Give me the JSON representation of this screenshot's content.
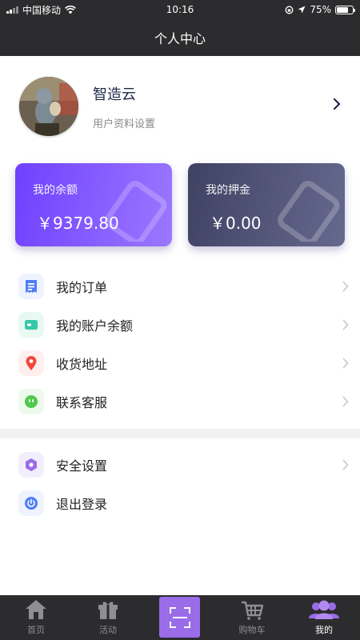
{
  "status_bar": {
    "carrier": "中国移动",
    "time": "10:16",
    "battery": "75%"
  },
  "header": {
    "title": "个人中心"
  },
  "profile": {
    "name": "智造云",
    "subtitle": "用户资料设置"
  },
  "cards": [
    {
      "title": "我的余额",
      "amount": "￥9379.80"
    },
    {
      "title": "我的押金",
      "amount": "￥0.00"
    }
  ],
  "menu_group_1": [
    {
      "label": "我的订单",
      "icon": "order-icon",
      "icon_color": "#4e7ef7",
      "bg": "#eef3ff"
    },
    {
      "label": "我的账户余额",
      "icon": "wallet-icon",
      "icon_color": "#35c8a8",
      "bg": "#e8f8f3"
    },
    {
      "label": "收货地址",
      "icon": "location-pin-icon",
      "icon_color": "#f0483a",
      "bg": "#fff0ee"
    },
    {
      "label": "联系客服",
      "icon": "chat-icon",
      "icon_color": "#4fc94d",
      "bg": "#edf9ec"
    }
  ],
  "menu_group_2": [
    {
      "label": "安全设置",
      "icon": "hexagon-icon",
      "icon_color": "#9a6ce8",
      "bg": "#f3eefd"
    },
    {
      "label": "退出登录",
      "icon": "power-icon",
      "icon_color": "#4e7ef7",
      "bg": "#eef3ff"
    }
  ],
  "tabbar": [
    {
      "label": "首页",
      "icon": "home-icon"
    },
    {
      "label": "活动",
      "icon": "gift-icon"
    },
    {
      "label": "",
      "icon": "scan-icon"
    },
    {
      "label": "购物车",
      "icon": "cart-icon"
    },
    {
      "label": "我的",
      "icon": "users-icon"
    }
  ],
  "colors": {
    "accent": "#9a6ce8",
    "dark_bar": "#2c2c2e"
  }
}
